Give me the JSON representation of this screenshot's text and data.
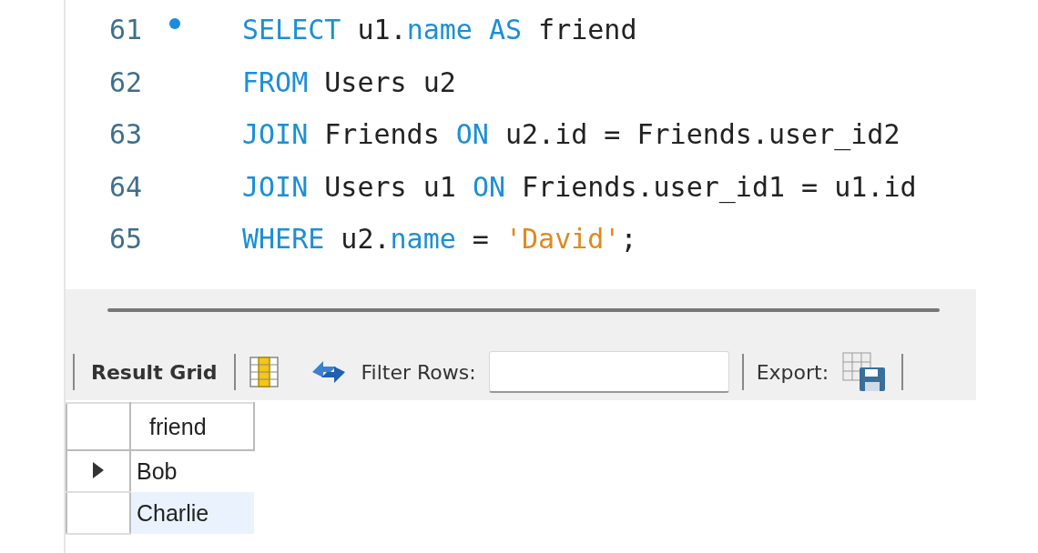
{
  "editor": {
    "lines": [
      {
        "number": "61",
        "marker": true,
        "tokens": [
          {
            "kind": "keyword",
            "text": "SELECT"
          },
          {
            "kind": "plain",
            "text": " u1."
          },
          {
            "kind": "keyword",
            "text": "name"
          },
          {
            "kind": "keyword",
            "text": " AS"
          },
          {
            "kind": "plain",
            "text": " friend"
          }
        ]
      },
      {
        "number": "62",
        "marker": false,
        "tokens": [
          {
            "kind": "keyword",
            "text": "FROM"
          },
          {
            "kind": "plain",
            "text": " Users u2"
          }
        ]
      },
      {
        "number": "63",
        "marker": false,
        "tokens": [
          {
            "kind": "keyword",
            "text": "JOIN"
          },
          {
            "kind": "plain",
            "text": " Friends "
          },
          {
            "kind": "keyword",
            "text": "ON"
          },
          {
            "kind": "plain",
            "text": " u2.id = Friends.user_id2"
          }
        ]
      },
      {
        "number": "64",
        "marker": false,
        "tokens": [
          {
            "kind": "keyword",
            "text": "JOIN"
          },
          {
            "kind": "plain",
            "text": " Users u1 "
          },
          {
            "kind": "keyword",
            "text": "ON"
          },
          {
            "kind": "plain",
            "text": " Friends.user_id1 = u1.id"
          }
        ]
      },
      {
        "number": "65",
        "marker": false,
        "tokens": [
          {
            "kind": "keyword",
            "text": "WHERE"
          },
          {
            "kind": "plain",
            "text": " u2."
          },
          {
            "kind": "keyword",
            "text": "name"
          },
          {
            "kind": "plain",
            "text": " = "
          },
          {
            "kind": "string",
            "text": "'David'"
          },
          {
            "kind": "plain",
            "text": ";"
          }
        ]
      }
    ]
  },
  "toolbar": {
    "result_tab": "Result Grid",
    "filter_label": "Filter Rows:",
    "export_label": "Export:"
  },
  "grid": {
    "columns": [
      "friend"
    ],
    "rows": [
      {
        "cells": [
          "Bob"
        ],
        "current": true,
        "selected": false
      },
      {
        "cells": [
          "Charlie"
        ],
        "current": false,
        "selected": true
      }
    ]
  }
}
